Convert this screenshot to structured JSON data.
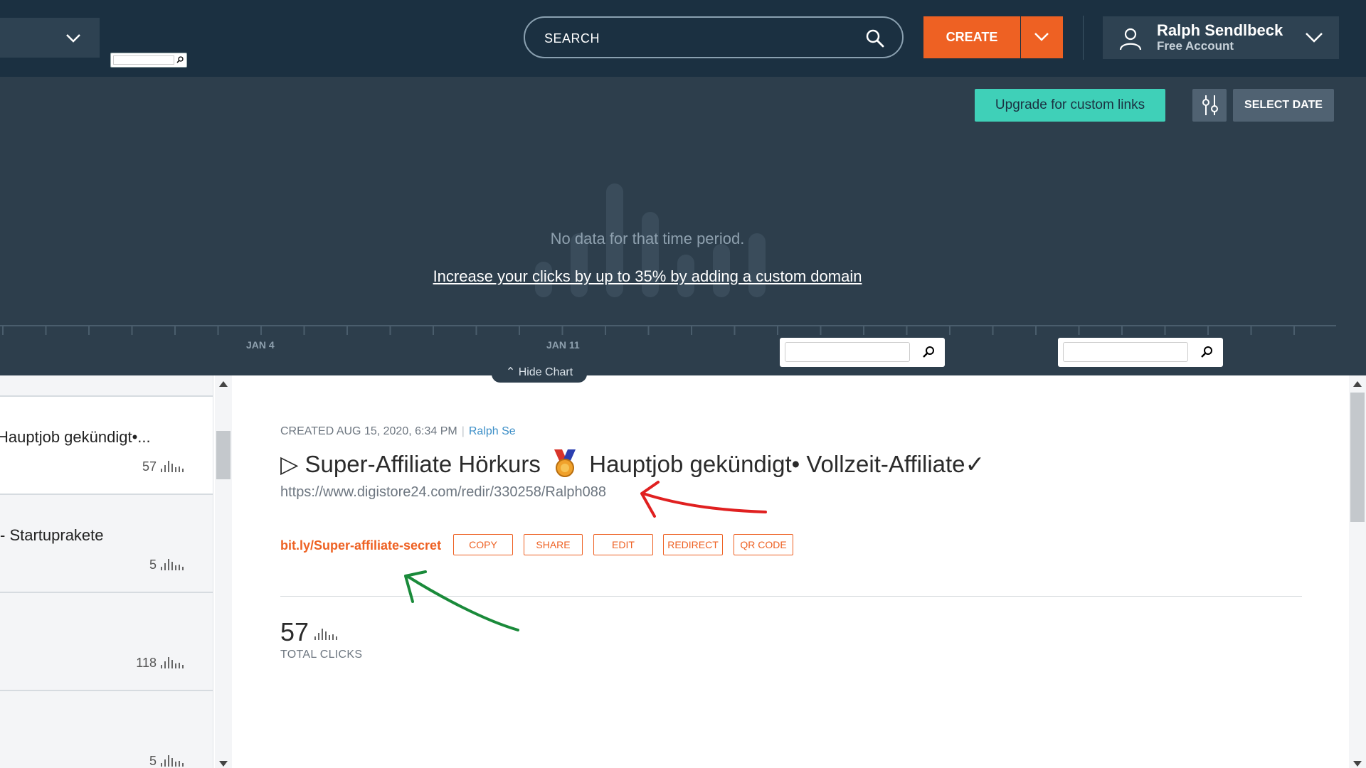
{
  "header": {
    "search_placeholder": "SEARCH",
    "create_label": "CREATE",
    "account_name": "Ralph Sendlbeck",
    "account_plan": "Free Account"
  },
  "chart_panel": {
    "upgrade_label": "Upgrade for custom links",
    "select_date_label": "SELECT DATE",
    "no_data_text": "No data for that time period.",
    "custom_domain_text": "Increase your clicks by up to 35% by adding a custom domain",
    "tick_labels": [
      "JAN 4",
      "JAN 11"
    ],
    "hide_chart_label": "Hide Chart"
  },
  "links_list": [
    {
      "title": "Hauptjob gekündigt•...",
      "clicks": "57"
    },
    {
      "title": "- Startuprakete",
      "clicks": "5"
    },
    {
      "title": "",
      "clicks": "118"
    },
    {
      "title": "",
      "clicks": "5"
    }
  ],
  "detail": {
    "created_text": "CREATED AUG 15, 2020, 6:34 PM",
    "author": "Ralph Se",
    "title_before": "▷ Super-Affiliate Hörkurs",
    "title_after": "Hauptjob gekündigt• Vollzeit-Affiliate✓",
    "long_url": "https://www.digistore24.com/redir/330258/Ralph088",
    "short_url": "bit.ly/Super-affiliate-secret",
    "actions": [
      "COPY",
      "SHARE",
      "EDIT",
      "REDIRECT",
      "QR CODE"
    ],
    "total_clicks": "57",
    "total_clicks_label": "TOTAL CLICKS"
  },
  "colors": {
    "brand_orange": "#ee6123",
    "header_bg": "#1b3041",
    "chart_bg": "#2d3e4c",
    "upgrade_teal": "#3fd0b8",
    "annotation_red": "#e02020",
    "annotation_green": "#1a8a3a"
  },
  "icons": {
    "search": "magnifier-icon",
    "create_caret": "chevron-down-icon",
    "account": "user-icon",
    "filter": "sliders-icon",
    "medal": "medal-icon",
    "clicks": "bar-chart-icon"
  }
}
